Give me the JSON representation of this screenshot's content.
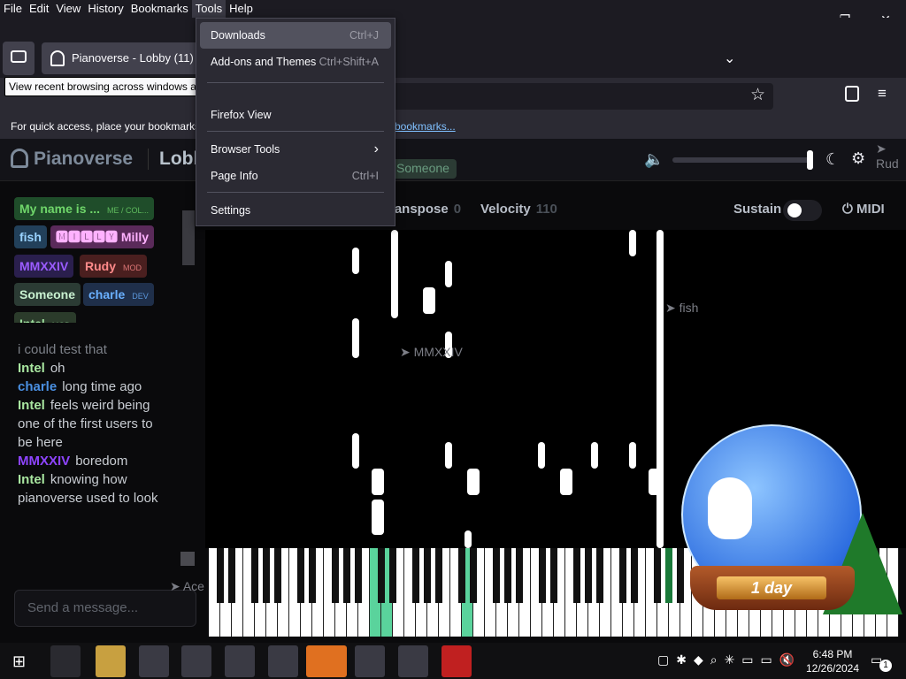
{
  "menubar": {
    "items": [
      "File",
      "Edit",
      "View",
      "History",
      "Bookmarks",
      "Tools",
      "Help"
    ]
  },
  "window": {
    "minimize": "—",
    "maximize": "❐",
    "close": "✕"
  },
  "tab": {
    "title": "Pianoverse - Lobby (11)"
  },
  "tooltip": {
    "text": "View recent browsing across windows and devices"
  },
  "bookmarks_bar": {
    "text": "For quick access, place your bookmarks",
    "link_tail": "bookmarks..."
  },
  "tools_menu": {
    "items": [
      {
        "label": "Downloads",
        "shortcut": "Ctrl+J"
      },
      {
        "label": "Add-ons and Themes",
        "shortcut": "Ctrl+Shift+A"
      },
      {
        "label": "Firefox View",
        "shortcut": ""
      },
      {
        "label": "Browser Tools",
        "shortcut": "›"
      },
      {
        "label": "Page Info",
        "shortcut": "Ctrl+I"
      },
      {
        "label": "Settings",
        "shortcut": ""
      }
    ]
  },
  "site": {
    "logo": "Pianoverse",
    "room": "Lobby",
    "someone_chip": "Someone",
    "toolbar": {
      "transpose_label": "ranspose",
      "transpose_value": "0",
      "velocity_label": "Velocity",
      "velocity_value": "110",
      "sustain_label": "Sustain",
      "midi_label": "MIDI"
    },
    "volume_level": 0.98
  },
  "users": [
    {
      "name": "My name is ...",
      "tag": "ME / COL...",
      "bg": "#1f4d2a",
      "fg": "#6fd66a"
    },
    {
      "name": "fish",
      "tag": "",
      "bg": "#22405a",
      "fg": "#9ad3ff"
    },
    {
      "name": "🅼🅸🅻🅻🆈 Milly",
      "tag": "",
      "bg": "#5a2a5a",
      "fg": "#ffb2ff"
    },
    {
      "name": "MMXXIV",
      "tag": "",
      "bg": "#2a1f4d",
      "fg": "#9b5cff"
    },
    {
      "name": "Rudy",
      "tag": "MOD",
      "bg": "#4a1f1f",
      "fg": "#ff8a8a"
    },
    {
      "name": "Someone",
      "tag": "",
      "bg": "#2b3b34",
      "fg": "#c8f0d0"
    },
    {
      "name": "charle",
      "tag": "DEV",
      "bg": "#1f2f4a",
      "fg": "#6ab0ff"
    },
    {
      "name": "Intel",
      "tag": "MOD",
      "bg": "#2b3b2b",
      "fg": "#9fe09f"
    }
  ],
  "chat": [
    {
      "name": "",
      "text": "i could test that",
      "color": "#7c8088"
    },
    {
      "name": "Intel",
      "text": "oh",
      "color": "#a8e6a0"
    },
    {
      "name": "charle",
      "text": "long time ago",
      "color": "#4a90e2"
    },
    {
      "name": "Intel",
      "text": "feels weird being one of the first users to be here",
      "color": "#a8e6a0"
    },
    {
      "name": "MMXXIV",
      "text": "boredom",
      "color": "#8e44ff"
    },
    {
      "name": "Intel",
      "text": "knowing how pianoverse used to look",
      "color": "#a8e6a0"
    }
  ],
  "chat_input": {
    "placeholder": "Send a message..."
  },
  "cursors": [
    {
      "name": "fish"
    },
    {
      "name": "MMXXIV"
    },
    {
      "name": "Ace"
    },
    {
      "name": "Rud"
    }
  ],
  "globe": {
    "label": "1 day"
  },
  "clock": {
    "time": "6:48 PM",
    "date": "12/26/2024"
  },
  "notification_count": "1"
}
